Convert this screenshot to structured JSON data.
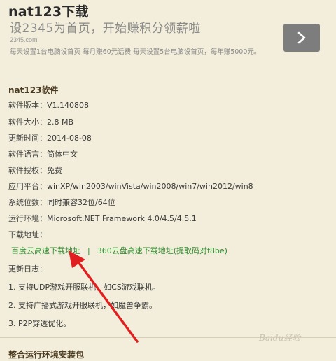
{
  "page": {
    "title": "nat123下载"
  },
  "ad": {
    "headline": "设2345为首页，开始赚积分领薪啦",
    "domain": "2345.com",
    "description": "每天设置1台电脑设首页 每月赚60元话费 每天设置5台电脑设首页，每年赚5000元。",
    "arrow_icon": "chevron-right-icon",
    "button_color": "#7d7d7d"
  },
  "software": {
    "heading": "nat123软件",
    "rows": [
      {
        "label": "软件版本：",
        "value": "V1.140808"
      },
      {
        "label": "软件大小：",
        "value": "2.8 MB"
      },
      {
        "label": "更新时间：",
        "value": "2014-08-08"
      },
      {
        "label": "软件语言：",
        "value": "简体中文"
      },
      {
        "label": "软件授权：",
        "value": "免费"
      },
      {
        "label": "应用平台：",
        "value": "winXP/win2003/winVista/win2008/win7/win2012/win8"
      },
      {
        "label": "系统位数：",
        "value": "同时兼容32位/64位"
      },
      {
        "label": "运行环境：",
        "value": "Microsoft.NET Framework 4.0/4.5/4.5.1"
      },
      {
        "label": "下载地址：",
        "value": ""
      }
    ],
    "links": {
      "baidu": "百度云高速下载地址",
      "separator": "|",
      "yun360": "360云盘高速下载地址(提取码对f8be)"
    },
    "changelog": {
      "title": "更新日志：",
      "items": [
        "1. 支持UDP游戏开服联机，如CS游戏联机。",
        "2. 支持广播式游戏开服联机，如魔兽争霸。",
        "3. P2P穿透优化。"
      ]
    },
    "runtime_heading": "整合运行环境安装包"
  },
  "watermark": "Baidu经验",
  "link_color": "#2e8b2e",
  "annotation_color": "#e02020"
}
